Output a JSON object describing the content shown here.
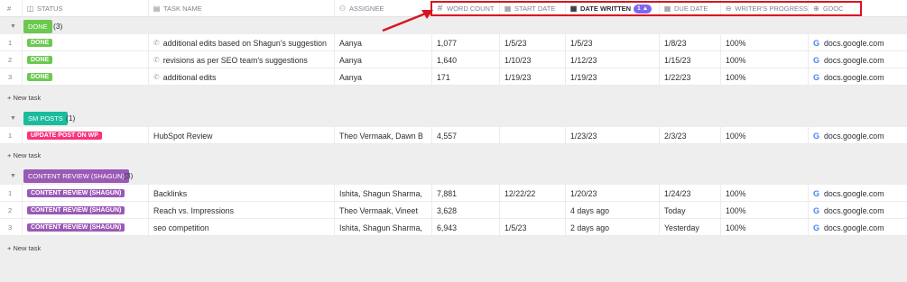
{
  "header": {
    "num": "#",
    "status": "STATUS",
    "task_name": "TASK NAME",
    "assignee": "ASSIGNEE",
    "word_count": "WORD COUNT",
    "start_date": "START DATE",
    "date_written": "DATE WRITTEN",
    "sort_badge": "1",
    "sort_arrow": "▲",
    "due_date": "DUE DATE",
    "writers_progress": "WRITER'S PROGRESS",
    "gdoc": "GDOC"
  },
  "groups": [
    {
      "name": "DONE",
      "count": "(3)",
      "color": "#6bc950",
      "rows": [
        {
          "num": "1",
          "status": "DONE",
          "task": "additional edits based on Shagun's suggestion",
          "assignee": "Aanya",
          "word_count": "1,077",
          "start_date": "1/5/23",
          "date_written": "1/5/23",
          "due_date": "1/8/23",
          "progress": "100%",
          "gdoc": "docs.google.com"
        },
        {
          "num": "2",
          "status": "DONE",
          "task": "revisions as per SEO team's suggestions",
          "assignee": "Aanya",
          "word_count": "1,640",
          "start_date": "1/10/23",
          "date_written": "1/12/23",
          "due_date": "1/15/23",
          "progress": "100%",
          "gdoc": "docs.google.com"
        },
        {
          "num": "3",
          "status": "DONE",
          "task": "additional edits",
          "assignee": "Aanya",
          "word_count": "171",
          "start_date": "1/19/23",
          "date_written": "1/19/23",
          "due_date": "1/22/23",
          "progress": "100%",
          "gdoc": "docs.google.com"
        }
      ]
    },
    {
      "name": "SM POSTS",
      "count": "(1)",
      "color": "#1bbc9c",
      "rows": [
        {
          "num": "1",
          "status": "UPDATE POST ON WP",
          "status_color": "#f9327b",
          "task": "HubSpot Review",
          "assignee": "Theo Vermaak, Dawn B",
          "word_count": "4,557",
          "start_date": "",
          "date_written": "1/23/23",
          "due_date": "2/3/23",
          "progress": "100%",
          "gdoc": "docs.google.com"
        }
      ]
    },
    {
      "name": "CONTENT REVIEW (SHAGUN)",
      "count": "(3)",
      "color": "#9b59b6",
      "rows": [
        {
          "num": "1",
          "status": "CONTENT REVIEW (SHAGUN)",
          "task": "Backlinks",
          "assignee": "Ishita, Shagun Sharma,",
          "word_count": "7,881",
          "start_date": "12/22/22",
          "date_written": "1/20/23",
          "due_date": "1/24/23",
          "progress": "100%",
          "gdoc": "docs.google.com"
        },
        {
          "num": "2",
          "status": "CONTENT REVIEW (SHAGUN)",
          "task": "Reach vs. Impressions",
          "assignee": "Theo Vermaak, Vineet",
          "word_count": "3,628",
          "start_date": "",
          "date_written": "4 days ago",
          "due_date": "Today",
          "progress": "100%",
          "gdoc": "docs.google.com"
        },
        {
          "num": "3",
          "status": "CONTENT REVIEW (SHAGUN)",
          "task": "seo competition",
          "assignee": "Ishita, Shagun Sharma,",
          "word_count": "6,943",
          "start_date": "1/5/23",
          "date_written": "2 days ago",
          "due_date": "Yesterday",
          "progress": "100%",
          "gdoc": "docs.google.com"
        }
      ]
    }
  ],
  "new_task_label": "+ New task",
  "colors": {
    "highlight": "#d8151f",
    "sort_pill": "#7b68ee"
  }
}
